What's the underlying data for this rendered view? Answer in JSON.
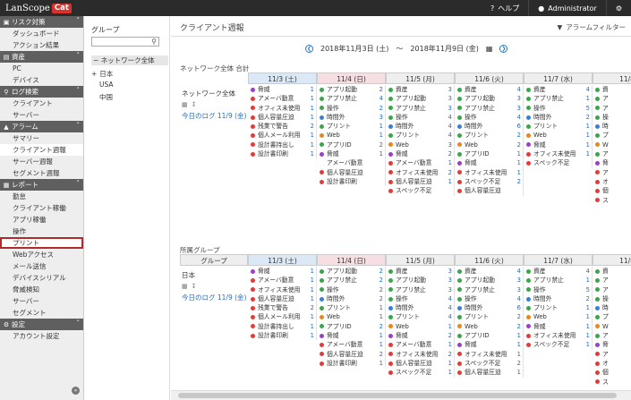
{
  "topbar": {
    "logo_text": "LanScope",
    "logo_badge": "Cat",
    "help": "ヘルプ",
    "user": "Administrator"
  },
  "sidebar": [
    {
      "header": "リスク対策",
      "icon": "shield-icon",
      "items": [
        "ダッシュボード",
        "アクション結果"
      ]
    },
    {
      "header": "資産",
      "icon": "monitor-icon",
      "items": [
        "PC",
        "デバイス"
      ]
    },
    {
      "header": "ログ検索",
      "icon": "search-icon",
      "items": [
        "クライアント",
        "サーバー"
      ]
    },
    {
      "header": "アラーム",
      "icon": "bell-icon",
      "items": [
        "サマリー",
        "クライアント週報",
        "サーバー週報",
        "セグメント週報"
      ]
    },
    {
      "header": "レポート",
      "icon": "report-icon",
      "items": [
        "勤怠",
        "クライアント稼働",
        "アプリ稼働",
        "操作",
        "プリント",
        "Webアクセス",
        "メール送信",
        "デバイスシリアル",
        "脅威検知",
        "サーバー",
        "セグメント"
      ]
    },
    {
      "header": "設定",
      "icon": "gear-icon",
      "items": [
        "アカウント設定"
      ]
    }
  ],
  "group_panel": {
    "title": "グループ",
    "root": "ネットワーク全体",
    "children": [
      "日本",
      "USA",
      "中国"
    ]
  },
  "main": {
    "title": "クライアント週報",
    "filter": "アラームフィルター",
    "date_from": "2018年11月3日 (土)",
    "sep": "〜",
    "date_to": "2018年11月9日 (金)",
    "days": [
      "11/3 (土)",
      "11/4 (日)",
      "11/5 (月)",
      "11/6 (火)",
      "11/7 (水)",
      "11/8"
    ],
    "section1": {
      "title": "ネットワーク全体 合計",
      "label": "ネットワーク全体",
      "today_link": "今日のログ 11/9 (金)",
      "columns": [
        [
          [
            "脅威",
            "1",
            "#9b3fc3"
          ],
          [
            "アメーバ動意",
            "1",
            "#e03c3c"
          ],
          [
            "オフィス未使用",
            "1",
            "#e03c3c"
          ],
          [
            "個人容量圧迫",
            "1",
            "#e03c3c"
          ],
          [
            "残業で警告",
            "2",
            "#e03c3c"
          ],
          [
            "個人メール利用",
            "1",
            "#e03c3c"
          ],
          [
            "設計書持出し",
            "1",
            "#e03c3c"
          ],
          [
            "設計書印刷",
            "1",
            "#e03c3c"
          ]
        ],
        [
          [
            "アプリ起動",
            "2",
            "#3aa64a"
          ],
          [
            "アプリ禁止",
            "4",
            "#3aa64a"
          ],
          [
            "操作",
            "2",
            "#3aa64a"
          ],
          [
            "時間外",
            "3",
            "#3a7fd6"
          ],
          [
            "プリント",
            "1",
            "#3aa64a"
          ],
          [
            "Web",
            "1",
            "#e8881c"
          ],
          [
            "アプリID",
            "2",
            "#3aa64a"
          ],
          [
            "脅威",
            "1",
            "#9b3fc3"
          ],
          [
            "アメーバ動意",
            "",
            ""
          ],
          [
            "個人容量圧迫",
            "",
            "#e03c3c"
          ],
          [
            "設計書印刷",
            "",
            "#e03c3c"
          ]
        ],
        [
          [
            "資産",
            "3",
            "#3aa64a"
          ],
          [
            "アプリ起動",
            "3",
            "#3aa64a"
          ],
          [
            "アプリ禁止",
            "3",
            "#3aa64a"
          ],
          [
            "操作",
            "4",
            "#3aa64a"
          ],
          [
            "時間外",
            "4",
            "#3a7fd6"
          ],
          [
            "プリント",
            "4",
            "#3aa64a"
          ],
          [
            "Web",
            "3",
            "#e8881c"
          ],
          [
            "脅威",
            "2",
            "#9b3fc3"
          ],
          [
            "アメーバ動意",
            "1",
            "#e03c3c"
          ],
          [
            "オフィス未使用",
            "2",
            "#e03c3c"
          ],
          [
            "個人容量圧迫",
            "1",
            "#e03c3c"
          ],
          [
            "スペック不足",
            "",
            "#e03c3c"
          ]
        ],
        [
          [
            "資産",
            "4",
            "#3aa64a"
          ],
          [
            "アプリ起動",
            "3",
            "#3aa64a"
          ],
          [
            "アプリ禁止",
            "3",
            "#3aa64a"
          ],
          [
            "操作",
            "4",
            "#3aa64a"
          ],
          [
            "時間外",
            "6",
            "#3a7fd6"
          ],
          [
            "プリント",
            "2",
            "#3aa64a"
          ],
          [
            "Web",
            "2",
            "#e8881c"
          ],
          [
            "アプリID",
            "1",
            "#3aa64a"
          ],
          [
            "脅威",
            "1",
            "#9b3fc3"
          ],
          [
            "オフィス未使用",
            "1",
            "#e03c3c"
          ],
          [
            "スペック不足",
            "2",
            "#e03c3c"
          ],
          [
            "個人容量圧迫",
            "",
            "#e03c3c"
          ]
        ],
        [
          [
            "資産",
            "4",
            "#3aa64a"
          ],
          [
            "アプリ禁止",
            "1",
            "#3aa64a"
          ],
          [
            "操作",
            "5",
            "#3aa64a"
          ],
          [
            "時間外",
            "2",
            "#3a7fd6"
          ],
          [
            "プリント",
            "1",
            "#3aa64a"
          ],
          [
            "Web",
            "1",
            "#e8881c"
          ],
          [
            "脅威",
            "1",
            "#9b3fc3"
          ],
          [
            "オフィス未使用",
            "1",
            "#e03c3c"
          ],
          [
            "スペック不足",
            "",
            "#e03c3c"
          ]
        ],
        [
          [
            "資",
            "",
            "#3aa64a"
          ],
          [
            "ア",
            "",
            "#3aa64a"
          ],
          [
            "ア",
            "",
            "#3aa64a"
          ],
          [
            "操",
            "",
            "#3aa64a"
          ],
          [
            "時",
            "",
            "#3a7fd6"
          ],
          [
            "プ",
            "",
            "#3aa64a"
          ],
          [
            "W",
            "",
            "#e8881c"
          ],
          [
            "ア",
            "",
            "#3aa64a"
          ],
          [
            "脅",
            "",
            "#9b3fc3"
          ],
          [
            "ア",
            "",
            "#e03c3c"
          ],
          [
            "オ",
            "",
            "#e03c3c"
          ],
          [
            "個",
            "",
            "#e03c3c"
          ],
          [
            "ス",
            "",
            "#e03c3c"
          ]
        ]
      ]
    },
    "section2": {
      "title": "所属グループ",
      "group_header": "グループ",
      "label": "日本",
      "today_link": "今日のログ 11/9 (金)",
      "columns": [
        [
          [
            "脅威",
            "1",
            "#9b3fc3"
          ],
          [
            "アメーバ動意",
            "1",
            "#e03c3c"
          ],
          [
            "オフィス未使用",
            "1",
            "#e03c3c"
          ],
          [
            "個人容量圧迫",
            "1",
            "#e03c3c"
          ],
          [
            "残業で警告",
            "2",
            "#e03c3c"
          ],
          [
            "個人メール利用",
            "1",
            "#e03c3c"
          ],
          [
            "設計書持出し",
            "1",
            "#e03c3c"
          ],
          [
            "設計書印刷",
            "1",
            "#e03c3c"
          ]
        ],
        [
          [
            "アプリ起動",
            "2",
            "#3aa64a"
          ],
          [
            "アプリ禁止",
            "2",
            "#3aa64a"
          ],
          [
            "操作",
            "2",
            "#3aa64a"
          ],
          [
            "時間外",
            "2",
            "#3a7fd6"
          ],
          [
            "プリント",
            "1",
            "#3aa64a"
          ],
          [
            "Web",
            "1",
            "#e8881c"
          ],
          [
            "アプリID",
            "2",
            "#3aa64a"
          ],
          [
            "脅威",
            "1",
            "#9b3fc3"
          ],
          [
            "アメーバ動意",
            "1",
            "#e03c3c"
          ],
          [
            "個人容量圧迫",
            "2",
            "#e03c3c"
          ],
          [
            "設計書印刷",
            "1",
            "#e03c3c"
          ]
        ],
        [
          [
            "資産",
            "3",
            "#3aa64a"
          ],
          [
            "アプリ起動",
            "3",
            "#3aa64a"
          ],
          [
            "アプリ禁止",
            "3",
            "#3aa64a"
          ],
          [
            "操作",
            "4",
            "#3aa64a"
          ],
          [
            "時間外",
            "4",
            "#3a7fd6"
          ],
          [
            "プリント",
            "4",
            "#3aa64a"
          ],
          [
            "Web",
            "1",
            "#e8881c"
          ],
          [
            "脅威",
            "2",
            "#9b3fc3"
          ],
          [
            "アメーバ動意",
            "1",
            "#e03c3c"
          ],
          [
            "オフィス未使用",
            "2",
            "#e03c3c"
          ],
          [
            "個人容量圧迫",
            "1",
            "#e03c3c"
          ],
          [
            "スペック不足",
            "1",
            "#e03c3c"
          ]
        ],
        [
          [
            "資産",
            "4",
            "#3aa64a"
          ],
          [
            "アプリ起動",
            "3",
            "#3aa64a"
          ],
          [
            "アプリ禁止",
            "3",
            "#3aa64a"
          ],
          [
            "操作",
            "4",
            "#3aa64a"
          ],
          [
            "時間外",
            "6",
            "#3a7fd6"
          ],
          [
            "プリント",
            "2",
            "#3aa64a"
          ],
          [
            "Web",
            "2",
            "#e8881c"
          ],
          [
            "アプリID",
            "1",
            "#3aa64a"
          ],
          [
            "脅威",
            "1",
            "#9b3fc3"
          ],
          [
            "オフィス未使用",
            "1",
            "#e03c3c"
          ],
          [
            "スペック不足",
            "2",
            "#e03c3c"
          ],
          [
            "個人容量圧迫",
            "1",
            "#e03c3c"
          ]
        ],
        [
          [
            "資産",
            "4",
            "#3aa64a"
          ],
          [
            "アプリ禁止",
            "1",
            "#3aa64a"
          ],
          [
            "操作",
            "5",
            "#3aa64a"
          ],
          [
            "時間外",
            "2",
            "#3a7fd6"
          ],
          [
            "プリント",
            "1",
            "#3aa64a"
          ],
          [
            "Web",
            "1",
            "#e8881c"
          ],
          [
            "脅威",
            "1",
            "#9b3fc3"
          ],
          [
            "オフィス未使用",
            "1",
            "#e03c3c"
          ],
          [
            "スペック不足",
            "1",
            "#e03c3c"
          ]
        ],
        [
          [
            "資",
            "",
            "#3aa64a"
          ],
          [
            "ア",
            "",
            "#3aa64a"
          ],
          [
            "ア",
            "",
            "#3aa64a"
          ],
          [
            "操",
            "",
            "#3aa64a"
          ],
          [
            "時",
            "",
            "#3a7fd6"
          ],
          [
            "プ",
            "",
            "#3aa64a"
          ],
          [
            "W",
            "",
            "#e8881c"
          ],
          [
            "ア",
            "",
            "#3aa64a"
          ],
          [
            "脅",
            "",
            "#9b3fc3"
          ],
          [
            "ア",
            "",
            "#e03c3c"
          ],
          [
            "オ",
            "",
            "#e03c3c"
          ],
          [
            "個",
            "",
            "#e03c3c"
          ],
          [
            "ス",
            "",
            "#e03c3c"
          ]
        ]
      ]
    }
  }
}
